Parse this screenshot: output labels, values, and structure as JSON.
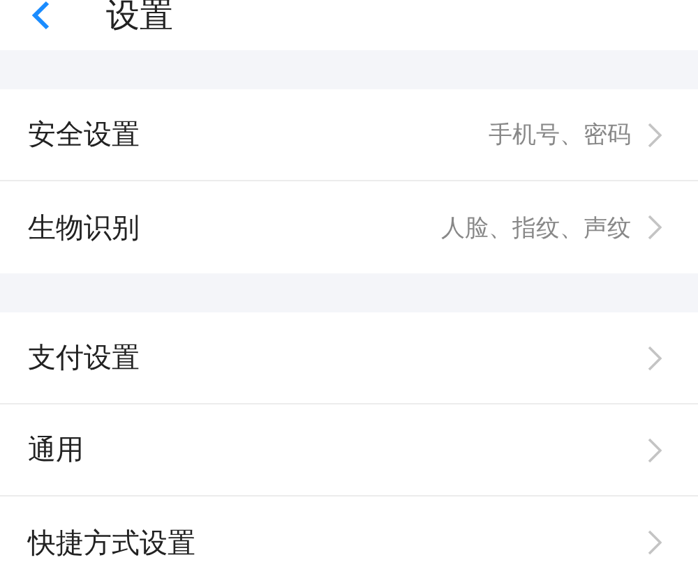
{
  "header": {
    "title": "设置"
  },
  "groups": [
    {
      "items": [
        {
          "label": "安全设置",
          "detail": "手机号、密码"
        },
        {
          "label": "生物识别",
          "detail": "人脸、指纹、声纹"
        }
      ]
    },
    {
      "items": [
        {
          "label": "支付设置"
        },
        {
          "label": "通用"
        },
        {
          "label": "快捷方式设置"
        }
      ]
    }
  ]
}
